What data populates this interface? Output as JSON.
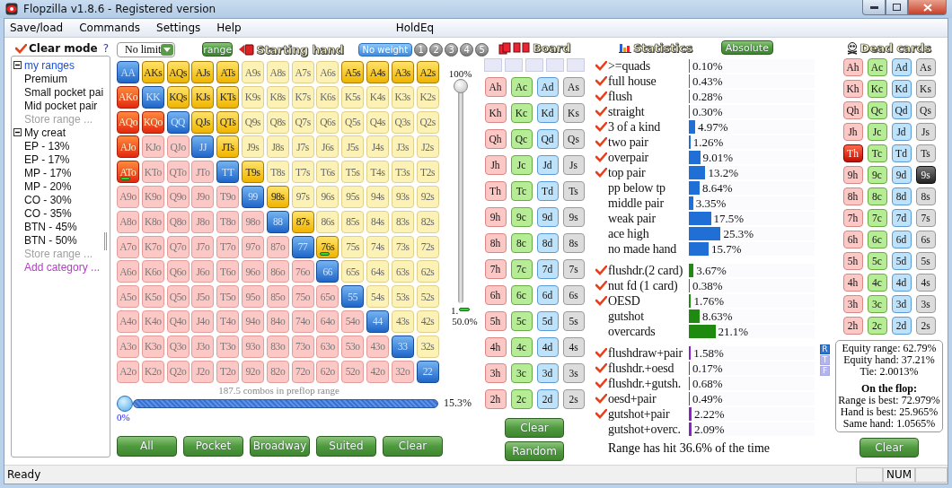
{
  "window": {
    "title": "Flopzilla v1.8.6 - Registered version"
  },
  "menu": [
    "Save/load",
    "Commands",
    "Settings",
    "Help",
    "HoldEq"
  ],
  "sidebar": {
    "clear_mode": {
      "label": "Clear mode",
      "checked": true
    },
    "help": "?",
    "tree": [
      {
        "label": "my ranges",
        "expanded": true,
        "children": [
          {
            "label": "Premium",
            "kind": "range"
          },
          {
            "label": "Small pocket pai",
            "kind": "range"
          },
          {
            "label": "Mid pocket pair",
            "kind": "range"
          },
          {
            "label": "Store range ...",
            "kind": "store"
          }
        ]
      },
      {
        "label": "My creat",
        "expanded": true,
        "children": [
          {
            "label": "EP - 13%",
            "kind": "range"
          },
          {
            "label": "EP - 17%",
            "kind": "range"
          },
          {
            "label": "MP - 17%",
            "kind": "range"
          },
          {
            "label": "MP - 20%",
            "kind": "range"
          },
          {
            "label": "CO - 30%",
            "kind": "range"
          },
          {
            "label": "CO - 35%",
            "kind": "range"
          },
          {
            "label": "BTN - 45%",
            "kind": "range"
          },
          {
            "label": "BTN - 50%",
            "kind": "range"
          },
          {
            "label": "Store range ...",
            "kind": "store"
          }
        ]
      },
      {
        "label": "Add category ...",
        "kind": "add"
      }
    ]
  },
  "toolbar": {
    "game": "No limit",
    "range_button": "range",
    "title": "Starting hand",
    "weights": [
      {
        "label": "No weight",
        "selected": true
      },
      {
        "label": "1",
        "selected": false
      },
      {
        "label": "2",
        "selected": false
      },
      {
        "label": "3",
        "selected": false
      },
      {
        "label": "4",
        "selected": false
      },
      {
        "label": "5",
        "selected": false
      }
    ]
  },
  "matrix": [
    [
      {
        "label": "AA",
        "selected": true,
        "weighted": false
      },
      {
        "label": "AKs",
        "selected": true,
        "weighted": false
      },
      {
        "label": "AQs",
        "selected": true,
        "weighted": false
      },
      {
        "label": "AJs",
        "selected": true,
        "weighted": false
      },
      {
        "label": "ATs",
        "selected": true,
        "weighted": false
      },
      {
        "label": "A9s",
        "selected": false,
        "weighted": false
      },
      {
        "label": "A8s",
        "selected": false,
        "weighted": false
      },
      {
        "label": "A7s",
        "selected": false,
        "weighted": false
      },
      {
        "label": "A6s",
        "selected": false,
        "weighted": false
      },
      {
        "label": "A5s",
        "selected": true,
        "weighted": false
      },
      {
        "label": "A4s",
        "selected": true,
        "weighted": false
      },
      {
        "label": "A3s",
        "selected": true,
        "weighted": false
      },
      {
        "label": "A2s",
        "selected": true,
        "weighted": false
      }
    ],
    [
      {
        "label": "AKo",
        "selected": true,
        "weighted": false
      },
      {
        "label": "KK",
        "selected": true,
        "weighted": false
      },
      {
        "label": "KQs",
        "selected": true,
        "weighted": false
      },
      {
        "label": "KJs",
        "selected": true,
        "weighted": false
      },
      {
        "label": "KTs",
        "selected": true,
        "weighted": false
      },
      {
        "label": "K9s",
        "selected": false,
        "weighted": false
      },
      {
        "label": "K8s",
        "selected": false,
        "weighted": false
      },
      {
        "label": "K7s",
        "selected": false,
        "weighted": false
      },
      {
        "label": "K6s",
        "selected": false,
        "weighted": false
      },
      {
        "label": "K5s",
        "selected": false,
        "weighted": false
      },
      {
        "label": "K4s",
        "selected": false,
        "weighted": false
      },
      {
        "label": "K3s",
        "selected": false,
        "weighted": false
      },
      {
        "label": "K2s",
        "selected": false,
        "weighted": false
      }
    ],
    [
      {
        "label": "AQo",
        "selected": true,
        "weighted": false
      },
      {
        "label": "KQo",
        "selected": true,
        "weighted": false
      },
      {
        "label": "QQ",
        "selected": true,
        "weighted": false
      },
      {
        "label": "QJs",
        "selected": true,
        "weighted": false
      },
      {
        "label": "QTs",
        "selected": true,
        "weighted": false
      },
      {
        "label": "Q9s",
        "selected": false,
        "weighted": false
      },
      {
        "label": "Q8s",
        "selected": false,
        "weighted": false
      },
      {
        "label": "Q7s",
        "selected": false,
        "weighted": false
      },
      {
        "label": "Q6s",
        "selected": false,
        "weighted": false
      },
      {
        "label": "Q5s",
        "selected": false,
        "weighted": false
      },
      {
        "label": "Q4s",
        "selected": false,
        "weighted": false
      },
      {
        "label": "Q3s",
        "selected": false,
        "weighted": false
      },
      {
        "label": "Q2s",
        "selected": false,
        "weighted": false
      }
    ],
    [
      {
        "label": "AJo",
        "selected": true,
        "weighted": false
      },
      {
        "label": "KJo",
        "selected": false,
        "weighted": false
      },
      {
        "label": "QJo",
        "selected": false,
        "weighted": false
      },
      {
        "label": "JJ",
        "selected": true,
        "weighted": false
      },
      {
        "label": "JTs",
        "selected": true,
        "weighted": false
      },
      {
        "label": "J9s",
        "selected": false,
        "weighted": false
      },
      {
        "label": "J8s",
        "selected": false,
        "weighted": false
      },
      {
        "label": "J7s",
        "selected": false,
        "weighted": false
      },
      {
        "label": "J6s",
        "selected": false,
        "weighted": false
      },
      {
        "label": "J5s",
        "selected": false,
        "weighted": false
      },
      {
        "label": "J4s",
        "selected": false,
        "weighted": false
      },
      {
        "label": "J3s",
        "selected": false,
        "weighted": false
      },
      {
        "label": "J2s",
        "selected": false,
        "weighted": false
      }
    ],
    [
      {
        "label": "ATo",
        "selected": true,
        "weighted": true
      },
      {
        "label": "KTo",
        "selected": false,
        "weighted": false
      },
      {
        "label": "QTo",
        "selected": false,
        "weighted": false
      },
      {
        "label": "JTo",
        "selected": false,
        "weighted": false
      },
      {
        "label": "TT",
        "selected": true,
        "weighted": false
      },
      {
        "label": "T9s",
        "selected": true,
        "weighted": false
      },
      {
        "label": "T8s",
        "selected": false,
        "weighted": false
      },
      {
        "label": "T7s",
        "selected": false,
        "weighted": false
      },
      {
        "label": "T6s",
        "selected": false,
        "weighted": false
      },
      {
        "label": "T5s",
        "selected": false,
        "weighted": false
      },
      {
        "label": "T4s",
        "selected": false,
        "weighted": false
      },
      {
        "label": "T3s",
        "selected": false,
        "weighted": false
      },
      {
        "label": "T2s",
        "selected": false,
        "weighted": false
      }
    ],
    [
      {
        "label": "A9o",
        "selected": false,
        "weighted": false
      },
      {
        "label": "K9o",
        "selected": false,
        "weighted": false
      },
      {
        "label": "Q9o",
        "selected": false,
        "weighted": false
      },
      {
        "label": "J9o",
        "selected": false,
        "weighted": false
      },
      {
        "label": "T9o",
        "selected": false,
        "weighted": false
      },
      {
        "label": "99",
        "selected": true,
        "weighted": false
      },
      {
        "label": "98s",
        "selected": true,
        "weighted": false
      },
      {
        "label": "97s",
        "selected": false,
        "weighted": false
      },
      {
        "label": "96s",
        "selected": false,
        "weighted": false
      },
      {
        "label": "95s",
        "selected": false,
        "weighted": false
      },
      {
        "label": "94s",
        "selected": false,
        "weighted": false
      },
      {
        "label": "93s",
        "selected": false,
        "weighted": false
      },
      {
        "label": "92s",
        "selected": false,
        "weighted": false
      }
    ],
    [
      {
        "label": "A8o",
        "selected": false,
        "weighted": false
      },
      {
        "label": "K8o",
        "selected": false,
        "weighted": false
      },
      {
        "label": "Q8o",
        "selected": false,
        "weighted": false
      },
      {
        "label": "J8o",
        "selected": false,
        "weighted": false
      },
      {
        "label": "T8o",
        "selected": false,
        "weighted": false
      },
      {
        "label": "98o",
        "selected": false,
        "weighted": false
      },
      {
        "label": "88",
        "selected": true,
        "weighted": false
      },
      {
        "label": "87s",
        "selected": true,
        "weighted": false
      },
      {
        "label": "86s",
        "selected": false,
        "weighted": false
      },
      {
        "label": "85s",
        "selected": false,
        "weighted": false
      },
      {
        "label": "84s",
        "selected": false,
        "weighted": false
      },
      {
        "label": "83s",
        "selected": false,
        "weighted": false
      },
      {
        "label": "82s",
        "selected": false,
        "weighted": false
      }
    ],
    [
      {
        "label": "A7o",
        "selected": false,
        "weighted": false
      },
      {
        "label": "K7o",
        "selected": false,
        "weighted": false
      },
      {
        "label": "Q7o",
        "selected": false,
        "weighted": false
      },
      {
        "label": "J7o",
        "selected": false,
        "weighted": false
      },
      {
        "label": "T7o",
        "selected": false,
        "weighted": false
      },
      {
        "label": "97o",
        "selected": false,
        "weighted": false
      },
      {
        "label": "87o",
        "selected": false,
        "weighted": false
      },
      {
        "label": "77",
        "selected": true,
        "weighted": false
      },
      {
        "label": "76s",
        "selected": true,
        "weighted": true
      },
      {
        "label": "75s",
        "selected": false,
        "weighted": false
      },
      {
        "label": "74s",
        "selected": false,
        "weighted": false
      },
      {
        "label": "73s",
        "selected": false,
        "weighted": false
      },
      {
        "label": "72s",
        "selected": false,
        "weighted": false
      }
    ],
    [
      {
        "label": "A6o",
        "selected": false,
        "weighted": false
      },
      {
        "label": "K6o",
        "selected": false,
        "weighted": false
      },
      {
        "label": "Q6o",
        "selected": false,
        "weighted": false
      },
      {
        "label": "J6o",
        "selected": false,
        "weighted": false
      },
      {
        "label": "T6o",
        "selected": false,
        "weighted": false
      },
      {
        "label": "96o",
        "selected": false,
        "weighted": false
      },
      {
        "label": "86o",
        "selected": false,
        "weighted": false
      },
      {
        "label": "76o",
        "selected": false,
        "weighted": false
      },
      {
        "label": "66",
        "selected": true,
        "weighted": false
      },
      {
        "label": "65s",
        "selected": false,
        "weighted": false
      },
      {
        "label": "64s",
        "selected": false,
        "weighted": false
      },
      {
        "label": "63s",
        "selected": false,
        "weighted": false
      },
      {
        "label": "62s",
        "selected": false,
        "weighted": false
      }
    ],
    [
      {
        "label": "A5o",
        "selected": false,
        "weighted": false
      },
      {
        "label": "K5o",
        "selected": false,
        "weighted": false
      },
      {
        "label": "Q5o",
        "selected": false,
        "weighted": false
      },
      {
        "label": "J5o",
        "selected": false,
        "weighted": false
      },
      {
        "label": "T5o",
        "selected": false,
        "weighted": false
      },
      {
        "label": "95o",
        "selected": false,
        "weighted": false
      },
      {
        "label": "85o",
        "selected": false,
        "weighted": false
      },
      {
        "label": "75o",
        "selected": false,
        "weighted": false
      },
      {
        "label": "65o",
        "selected": false,
        "weighted": false
      },
      {
        "label": "55",
        "selected": true,
        "weighted": false
      },
      {
        "label": "54s",
        "selected": false,
        "weighted": false
      },
      {
        "label": "53s",
        "selected": false,
        "weighted": false
      },
      {
        "label": "52s",
        "selected": false,
        "weighted": false
      }
    ],
    [
      {
        "label": "A4o",
        "selected": false,
        "weighted": false
      },
      {
        "label": "K4o",
        "selected": false,
        "weighted": false
      },
      {
        "label": "Q4o",
        "selected": false,
        "weighted": false
      },
      {
        "label": "J4o",
        "selected": false,
        "weighted": false
      },
      {
        "label": "T4o",
        "selected": false,
        "weighted": false
      },
      {
        "label": "94o",
        "selected": false,
        "weighted": false
      },
      {
        "label": "84o",
        "selected": false,
        "weighted": false
      },
      {
        "label": "74o",
        "selected": false,
        "weighted": false
      },
      {
        "label": "64o",
        "selected": false,
        "weighted": false
      },
      {
        "label": "54o",
        "selected": false,
        "weighted": false
      },
      {
        "label": "44",
        "selected": true,
        "weighted": false
      },
      {
        "label": "43s",
        "selected": false,
        "weighted": false
      },
      {
        "label": "42s",
        "selected": false,
        "weighted": false
      }
    ],
    [
      {
        "label": "A3o",
        "selected": false,
        "weighted": false
      },
      {
        "label": "K3o",
        "selected": false,
        "weighted": false
      },
      {
        "label": "Q3o",
        "selected": false,
        "weighted": false
      },
      {
        "label": "J3o",
        "selected": false,
        "weighted": false
      },
      {
        "label": "T3o",
        "selected": false,
        "weighted": false
      },
      {
        "label": "93o",
        "selected": false,
        "weighted": false
      },
      {
        "label": "83o",
        "selected": false,
        "weighted": false
      },
      {
        "label": "73o",
        "selected": false,
        "weighted": false
      },
      {
        "label": "63o",
        "selected": false,
        "weighted": false
      },
      {
        "label": "53o",
        "selected": false,
        "weighted": false
      },
      {
        "label": "43o",
        "selected": false,
        "weighted": false
      },
      {
        "label": "33",
        "selected": true,
        "weighted": false
      },
      {
        "label": "32s",
        "selected": false,
        "weighted": false
      }
    ],
    [
      {
        "label": "A2o",
        "selected": false,
        "weighted": false
      },
      {
        "label": "K2o",
        "selected": false,
        "weighted": false
      },
      {
        "label": "Q2o",
        "selected": false,
        "weighted": false
      },
      {
        "label": "J2o",
        "selected": false,
        "weighted": false
      },
      {
        "label": "T2o",
        "selected": false,
        "weighted": false
      },
      {
        "label": "92o",
        "selected": false,
        "weighted": false
      },
      {
        "label": "82o",
        "selected": false,
        "weighted": false
      },
      {
        "label": "72o",
        "selected": false,
        "weighted": false
      },
      {
        "label": "62o",
        "selected": false,
        "weighted": false
      },
      {
        "label": "52o",
        "selected": false,
        "weighted": false
      },
      {
        "label": "42o",
        "selected": false,
        "weighted": false
      },
      {
        "label": "32o",
        "selected": false,
        "weighted": false
      },
      {
        "label": "22",
        "selected": true,
        "weighted": false
      }
    ]
  ],
  "weight_slider": {
    "top_label": "100%",
    "level": 1,
    "bottom_mark": "1.",
    "bottom_label": "50.0%"
  },
  "range_slider": {
    "caption": "187.5 combos in preflop range",
    "level": 0,
    "min_label": "0%",
    "max_label": "15.3%"
  },
  "matrix_buttons": [
    "All",
    "Pocket",
    "Broadway",
    "Suited",
    "Clear"
  ],
  "board": {
    "title": "Board",
    "cards": [
      [
        {
          "label": "Ah",
          "kind": "hearts",
          "selected": false
        },
        {
          "label": "Ac",
          "kind": "clubs",
          "selected": false
        },
        {
          "label": "Ad",
          "kind": "diamonds",
          "selected": false
        },
        {
          "label": "As",
          "kind": "spades",
          "selected": false
        }
      ],
      [
        {
          "label": "Kh",
          "kind": "hearts",
          "selected": false
        },
        {
          "label": "Kc",
          "kind": "clubs",
          "selected": false
        },
        {
          "label": "Kd",
          "kind": "diamonds",
          "selected": false
        },
        {
          "label": "Ks",
          "kind": "spades",
          "selected": false
        }
      ],
      [
        {
          "label": "Qh",
          "kind": "hearts",
          "selected": false
        },
        {
          "label": "Qc",
          "kind": "clubs",
          "selected": false
        },
        {
          "label": "Qd",
          "kind": "diamonds",
          "selected": false
        },
        {
          "label": "Qs",
          "kind": "spades",
          "selected": false
        }
      ],
      [
        {
          "label": "Jh",
          "kind": "hearts",
          "selected": false
        },
        {
          "label": "Jc",
          "kind": "clubs",
          "selected": false
        },
        {
          "label": "Jd",
          "kind": "diamonds",
          "selected": false
        },
        {
          "label": "Js",
          "kind": "spades",
          "selected": false
        }
      ],
      [
        {
          "label": "Th",
          "kind": "hearts",
          "selected": false
        },
        {
          "label": "Tc",
          "kind": "clubs",
          "selected": false
        },
        {
          "label": "Td",
          "kind": "diamonds",
          "selected": false
        },
        {
          "label": "Ts",
          "kind": "spades",
          "selected": false
        }
      ],
      [
        {
          "label": "9h",
          "kind": "hearts",
          "selected": false
        },
        {
          "label": "9c",
          "kind": "clubs",
          "selected": false
        },
        {
          "label": "9d",
          "kind": "diamonds",
          "selected": false
        },
        {
          "label": "9s",
          "kind": "spades",
          "selected": false
        }
      ],
      [
        {
          "label": "8h",
          "kind": "hearts",
          "selected": false
        },
        {
          "label": "8c",
          "kind": "clubs",
          "selected": false
        },
        {
          "label": "8d",
          "kind": "diamonds",
          "selected": false
        },
        {
          "label": "8s",
          "kind": "spades",
          "selected": false
        }
      ],
      [
        {
          "label": "7h",
          "kind": "hearts",
          "selected": false
        },
        {
          "label": "7c",
          "kind": "clubs",
          "selected": false
        },
        {
          "label": "7d",
          "kind": "diamonds",
          "selected": false
        },
        {
          "label": "7s",
          "kind": "spades",
          "selected": false
        }
      ],
      [
        {
          "label": "6h",
          "kind": "hearts",
          "selected": false
        },
        {
          "label": "6c",
          "kind": "clubs",
          "selected": false
        },
        {
          "label": "6d",
          "kind": "diamonds",
          "selected": false
        },
        {
          "label": "6s",
          "kind": "spades",
          "selected": false
        }
      ],
      [
        {
          "label": "5h",
          "kind": "hearts",
          "selected": false
        },
        {
          "label": "5c",
          "kind": "clubs",
          "selected": false
        },
        {
          "label": "5d",
          "kind": "diamonds",
          "selected": false
        },
        {
          "label": "5s",
          "kind": "spades",
          "selected": false
        }
      ],
      [
        {
          "label": "4h",
          "kind": "hearts",
          "selected": false
        },
        {
          "label": "4c",
          "kind": "clubs",
          "selected": false
        },
        {
          "label": "4d",
          "kind": "diamonds",
          "selected": false
        },
        {
          "label": "4s",
          "kind": "spades",
          "selected": false
        }
      ],
      [
        {
          "label": "3h",
          "kind": "hearts",
          "selected": false
        },
        {
          "label": "3c",
          "kind": "clubs",
          "selected": false
        },
        {
          "label": "3d",
          "kind": "diamonds",
          "selected": false
        },
        {
          "label": "3s",
          "kind": "spades",
          "selected": false
        }
      ],
      [
        {
          "label": "2h",
          "kind": "hearts",
          "selected": false
        },
        {
          "label": "2c",
          "kind": "clubs",
          "selected": false
        },
        {
          "label": "2d",
          "kind": "diamonds",
          "selected": false
        },
        {
          "label": "2s",
          "kind": "spades",
          "selected": false
        }
      ]
    ],
    "buttons": [
      "Clear",
      "Random"
    ]
  },
  "statistics": {
    "title": "Statistics",
    "mode_button": "Absolute",
    "groups": [
      {
        "color": "#1f6fd6",
        "rows": [
          {
            "label": ">=quads",
            "checked": true,
            "value": "0.10%",
            "level": 0.001
          },
          {
            "label": "full house",
            "checked": true,
            "value": "0.43%",
            "level": 0.0043
          },
          {
            "label": "flush",
            "checked": true,
            "value": "0.28%",
            "level": 0.0028
          },
          {
            "label": "straight",
            "checked": true,
            "value": "0.30%",
            "level": 0.003
          },
          {
            "label": "3 of a kind",
            "checked": true,
            "value": "4.97%",
            "level": 0.0497
          },
          {
            "label": "two pair",
            "checked": true,
            "value": "1.26%",
            "level": 0.0126
          },
          {
            "label": "overpair",
            "checked": true,
            "value": "9.01%",
            "level": 0.0901
          },
          {
            "label": "top pair",
            "checked": true,
            "value": "13.2%",
            "level": 0.132
          },
          {
            "label": "pp below tp",
            "checked": false,
            "value": "8.64%",
            "level": 0.0864
          },
          {
            "label": "middle pair",
            "checked": false,
            "value": "3.35%",
            "level": 0.0335
          },
          {
            "label": "weak pair",
            "checked": false,
            "value": "17.5%",
            "level": 0.175
          },
          {
            "label": "ace high",
            "checked": false,
            "value": "25.3%",
            "level": 0.253
          },
          {
            "label": "no made hand",
            "checked": false,
            "value": "15.7%",
            "level": 0.157
          }
        ]
      },
      {
        "color": "#1e8a10",
        "rows": [
          {
            "label": "flushdr.(2 card)",
            "checked": true,
            "value": "3.67%",
            "level": 0.0367
          },
          {
            "label": "nut fd (1 card)",
            "checked": true,
            "value": "0.38%",
            "level": 0.0038
          },
          {
            "label": "OESD",
            "checked": true,
            "value": "1.76%",
            "level": 0.0176
          },
          {
            "label": "gutshot",
            "checked": false,
            "value": "8.63%",
            "level": 0.0863
          },
          {
            "label": "overcards",
            "checked": false,
            "value": "21.1%",
            "level": 0.211
          }
        ]
      },
      {
        "color": "#8a22c8",
        "rows": [
          {
            "label": "flushdraw+pair",
            "checked": true,
            "value": "1.58%",
            "level": 0.0158
          },
          {
            "label": "flushdr.+oesd",
            "checked": true,
            "value": "0.17%",
            "level": 0.0017
          },
          {
            "label": "flushdr.+gutsh.",
            "checked": true,
            "value": "0.68%",
            "level": 0.0068
          },
          {
            "label": "oesd+pair",
            "checked": true,
            "value": "0.49%",
            "level": 0.0049
          },
          {
            "label": "gutshot+pair",
            "checked": true,
            "value": "2.22%",
            "level": 0.0222
          },
          {
            "label": "gutshot+overc.",
            "checked": false,
            "value": "2.09%",
            "level": 0.0209
          }
        ]
      }
    ],
    "summary": "Range has hit 36.6% of the time"
  },
  "street_buttons": [
    {
      "label": "R",
      "selected": true
    },
    {
      "label": "T",
      "selected": false
    },
    {
      "label": "F",
      "selected": false
    }
  ],
  "dead_cards": {
    "title": "Dead cards",
    "cards": [
      [
        {
          "label": "Ah",
          "kind": "hearts",
          "selected": false
        },
        {
          "label": "Ac",
          "kind": "clubs",
          "selected": false
        },
        {
          "label": "Ad",
          "kind": "diamonds",
          "selected": false
        },
        {
          "label": "As",
          "kind": "spades",
          "selected": false
        }
      ],
      [
        {
          "label": "Kh",
          "kind": "hearts",
          "selected": false
        },
        {
          "label": "Kc",
          "kind": "clubs",
          "selected": false
        },
        {
          "label": "Kd",
          "kind": "diamonds",
          "selected": false
        },
        {
          "label": "Ks",
          "kind": "spades",
          "selected": false
        }
      ],
      [
        {
          "label": "Qh",
          "kind": "hearts",
          "selected": false
        },
        {
          "label": "Qc",
          "kind": "clubs",
          "selected": false
        },
        {
          "label": "Qd",
          "kind": "diamonds",
          "selected": false
        },
        {
          "label": "Qs",
          "kind": "spades",
          "selected": false
        }
      ],
      [
        {
          "label": "Jh",
          "kind": "hearts",
          "selected": false
        },
        {
          "label": "Jc",
          "kind": "clubs",
          "selected": false
        },
        {
          "label": "Jd",
          "kind": "diamonds",
          "selected": false
        },
        {
          "label": "Js",
          "kind": "spades",
          "selected": false
        }
      ],
      [
        {
          "label": "Th",
          "kind": "hearts",
          "selected": true
        },
        {
          "label": "Tc",
          "kind": "clubs",
          "selected": false
        },
        {
          "label": "Td",
          "kind": "diamonds",
          "selected": false
        },
        {
          "label": "Ts",
          "kind": "spades",
          "selected": false
        }
      ],
      [
        {
          "label": "9h",
          "kind": "hearts",
          "selected": false
        },
        {
          "label": "9c",
          "kind": "clubs",
          "selected": false
        },
        {
          "label": "9d",
          "kind": "diamonds",
          "selected": false
        },
        {
          "label": "9s",
          "kind": "spades",
          "selected": true
        }
      ],
      [
        {
          "label": "8h",
          "kind": "hearts",
          "selected": false
        },
        {
          "label": "8c",
          "kind": "clubs",
          "selected": false
        },
        {
          "label": "8d",
          "kind": "diamonds",
          "selected": false
        },
        {
          "label": "8s",
          "kind": "spades",
          "selected": false
        }
      ],
      [
        {
          "label": "7h",
          "kind": "hearts",
          "selected": false
        },
        {
          "label": "7c",
          "kind": "clubs",
          "selected": false
        },
        {
          "label": "7d",
          "kind": "diamonds",
          "selected": false
        },
        {
          "label": "7s",
          "kind": "spades",
          "selected": false
        }
      ],
      [
        {
          "label": "6h",
          "kind": "hearts",
          "selected": false
        },
        {
          "label": "6c",
          "kind": "clubs",
          "selected": false
        },
        {
          "label": "6d",
          "kind": "diamonds",
          "selected": false
        },
        {
          "label": "6s",
          "kind": "spades",
          "selected": false
        }
      ],
      [
        {
          "label": "5h",
          "kind": "hearts",
          "selected": false
        },
        {
          "label": "5c",
          "kind": "clubs",
          "selected": false
        },
        {
          "label": "5d",
          "kind": "diamonds",
          "selected": false
        },
        {
          "label": "5s",
          "kind": "spades",
          "selected": false
        }
      ],
      [
        {
          "label": "4h",
          "kind": "hearts",
          "selected": false
        },
        {
          "label": "4c",
          "kind": "clubs",
          "selected": false
        },
        {
          "label": "4d",
          "kind": "diamonds",
          "selected": false
        },
        {
          "label": "4s",
          "kind": "spades",
          "selected": false
        }
      ],
      [
        {
          "label": "3h",
          "kind": "hearts",
          "selected": false
        },
        {
          "label": "3c",
          "kind": "clubs",
          "selected": false
        },
        {
          "label": "3d",
          "kind": "diamonds",
          "selected": false
        },
        {
          "label": "3s",
          "kind": "spades",
          "selected": false
        }
      ],
      [
        {
          "label": "2h",
          "kind": "hearts",
          "selected": false
        },
        {
          "label": "2c",
          "kind": "clubs",
          "selected": false
        },
        {
          "label": "2d",
          "kind": "diamonds",
          "selected": false
        },
        {
          "label": "2s",
          "kind": "spades",
          "selected": false
        }
      ]
    ],
    "equity": [
      {
        "text": "Equity range: 62.79%",
        "kind": "line"
      },
      {
        "text": "Equity hand: 37.21%",
        "kind": "line"
      },
      {
        "text": "Tie: 2.0013%",
        "kind": "line"
      },
      {
        "text": "On the flop:",
        "kind": "heading"
      },
      {
        "text": "Range is best: 72.979%",
        "kind": "line"
      },
      {
        "text": "Hand is best: 25.965%",
        "kind": "line"
      },
      {
        "text": "Same hand: 1.0565%",
        "kind": "line"
      }
    ],
    "button": "Clear"
  },
  "status_bar": {
    "text": "Ready",
    "indicators": [
      "NUM"
    ]
  }
}
